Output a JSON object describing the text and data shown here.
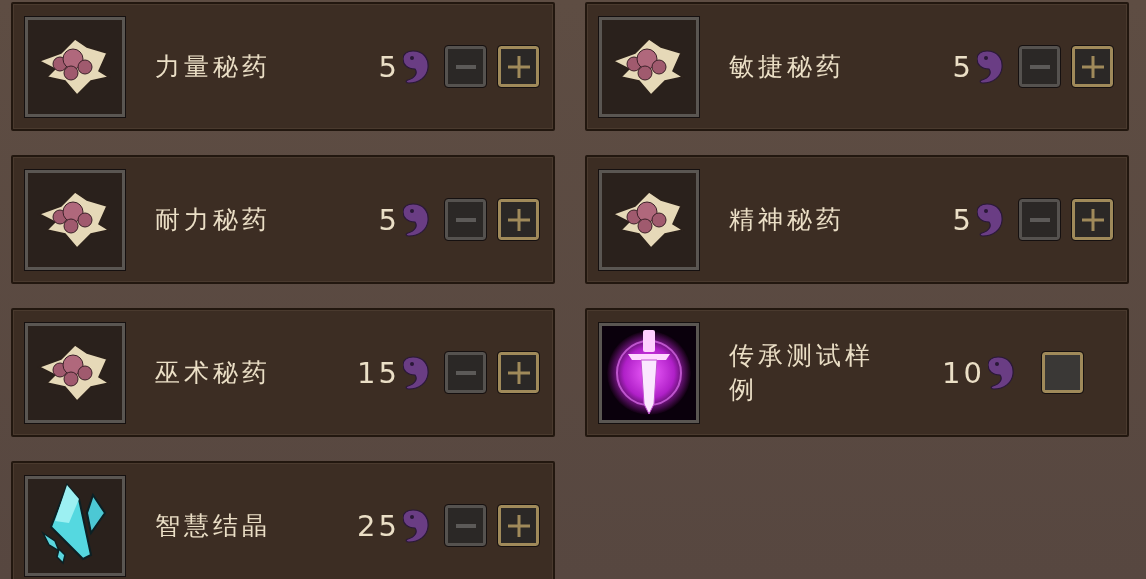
{
  "items": [
    {
      "name": "力量秘药",
      "cost": "5",
      "kind": "potion"
    },
    {
      "name": "耐力秘药",
      "cost": "5",
      "kind": "potion"
    },
    {
      "name": "巫术秘药",
      "cost": "15",
      "kind": "potion"
    },
    {
      "name": "智慧结晶",
      "cost": "25",
      "kind": "crystal"
    },
    {
      "name": "敏捷秘药",
      "cost": "5",
      "kind": "potion"
    },
    {
      "name": "精神秘药",
      "cost": "5",
      "kind": "potion"
    },
    {
      "name": "传承测试样例",
      "cost": "10",
      "kind": "relic",
      "checked": false
    }
  ]
}
